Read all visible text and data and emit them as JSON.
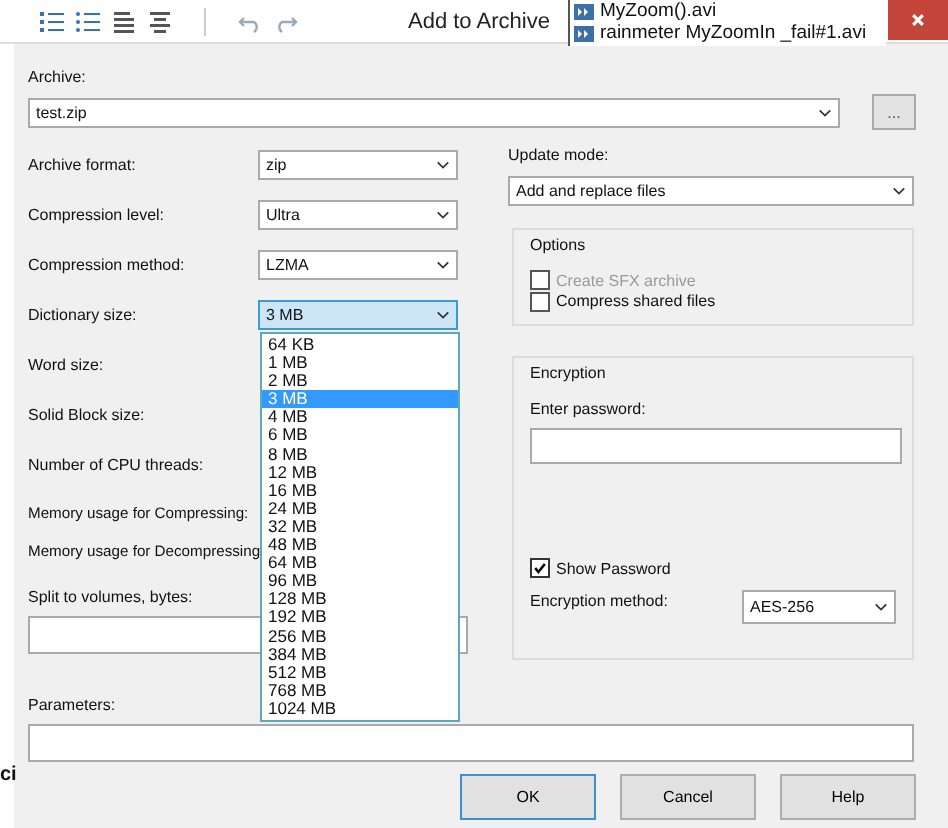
{
  "window": {
    "title": "Add to Archive"
  },
  "background_files": [
    {
      "name": "MyZoom().avi"
    },
    {
      "name": "rainmeter MyZoomIn _fail#1.avi"
    }
  ],
  "background_text": "ci",
  "archive": {
    "label": "Archive:",
    "value": "test.zip",
    "browse": "..."
  },
  "settings": [
    {
      "label": "Archive format:",
      "value": "zip",
      "focused": false
    },
    {
      "label": "Compression level:",
      "value": "Ultra",
      "focused": false
    },
    {
      "label": "Compression method:",
      "value": "LZMA",
      "focused": false
    },
    {
      "label": "Dictionary size:",
      "value": "3 MB",
      "focused": true
    },
    {
      "label": "Word size:"
    },
    {
      "label": "Solid Block size:"
    },
    {
      "label": "Number of CPU threads:"
    }
  ],
  "memory": [
    {
      "label": "Memory usage for Compressing:"
    },
    {
      "label": "Memory usage for Decompressing"
    }
  ],
  "split": {
    "label": "Split to volumes, bytes:"
  },
  "parameters": {
    "label": "Parameters:"
  },
  "update_mode": {
    "label": "Update mode:",
    "value": "Add and replace files"
  },
  "options": {
    "title": "Options",
    "items": [
      {
        "label": "Create SFX archive",
        "checked": false,
        "disabled": true
      },
      {
        "label": "Compress shared files",
        "checked": false,
        "disabled": false
      }
    ]
  },
  "encryption": {
    "title": "Encryption",
    "password_label": "Enter password:",
    "show_password": {
      "label": "Show Password",
      "checked": true
    },
    "method_label": "Encryption method:",
    "method": "AES-256"
  },
  "dropdown": [
    {
      "label": "64 KB",
      "selected": false
    },
    {
      "label": "1 MB",
      "selected": false
    },
    {
      "label": "2 MB",
      "selected": false
    },
    {
      "label": "3 MB",
      "selected": true
    },
    {
      "label": "4 MB",
      "selected": false
    },
    {
      "label": "6 MB",
      "selected": false
    },
    {
      "label": "8 MB",
      "selected": false
    },
    {
      "label": "12 MB",
      "selected": false
    },
    {
      "label": "16 MB",
      "selected": false
    },
    {
      "label": "24 MB",
      "selected": false
    },
    {
      "label": "32 MB",
      "selected": false
    },
    {
      "label": "48 MB",
      "selected": false
    },
    {
      "label": "64 MB",
      "selected": false
    },
    {
      "label": "96 MB",
      "selected": false
    },
    {
      "label": "128 MB",
      "selected": false
    },
    {
      "label": "192 MB",
      "selected": false
    },
    {
      "label": "256 MB",
      "selected": false
    },
    {
      "label": "384 MB",
      "selected": false
    },
    {
      "label": "512 MB",
      "selected": false
    },
    {
      "label": "768 MB",
      "selected": false
    },
    {
      "label": "1024 MB",
      "selected": false
    }
  ],
  "buttons": [
    {
      "label": "OK",
      "default": true
    },
    {
      "label": "Cancel",
      "default": false
    },
    {
      "label": "Help",
      "default": false
    }
  ]
}
